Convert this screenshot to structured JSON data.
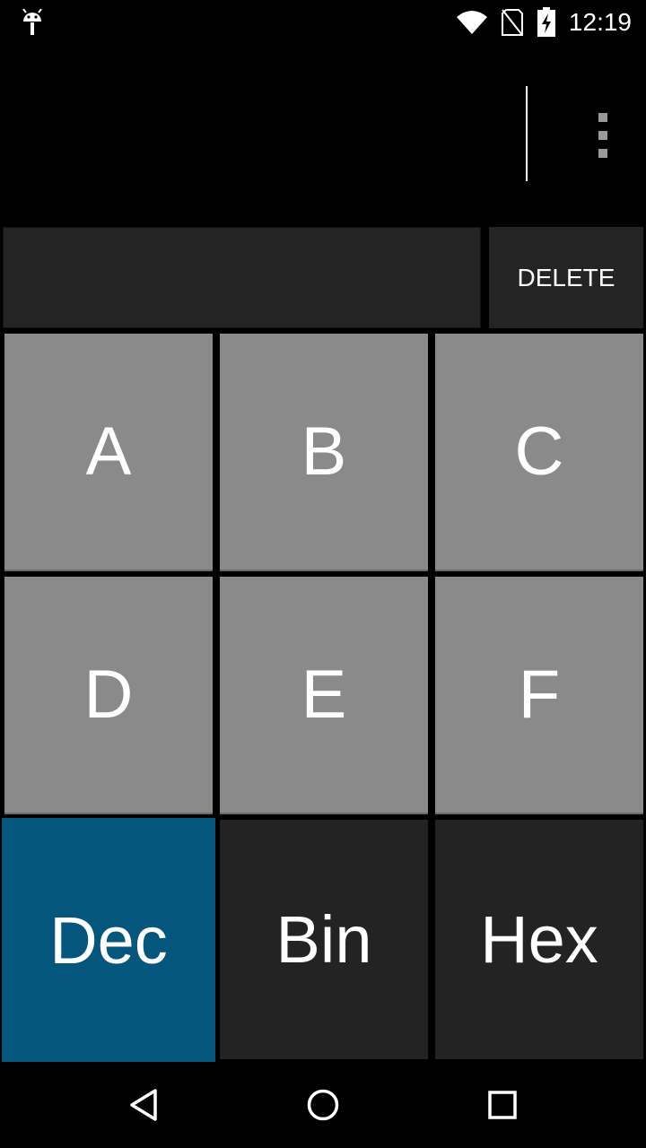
{
  "status_bar": {
    "time": "12:19",
    "icons": [
      "android-icon",
      "wifi-icon",
      "no-sim-icon",
      "battery-charging-icon"
    ]
  },
  "toolbar": {
    "overflow_icon": "more-vert-icon",
    "delete_label": "DELETE"
  },
  "input": {
    "value": ""
  },
  "keys": {
    "hex_digits": [
      "A",
      "B",
      "C",
      "D",
      "E",
      "F"
    ],
    "modes": [
      "Dec",
      "Bin",
      "Hex"
    ],
    "active_mode": "Dec"
  },
  "colors": {
    "active_mode": "#05567d",
    "hex_key": "#8a8a8a",
    "dark_key": "#232323",
    "background": "#000000"
  },
  "nav_bar": {
    "icons": [
      "back-icon",
      "home-icon",
      "recents-icon"
    ]
  }
}
